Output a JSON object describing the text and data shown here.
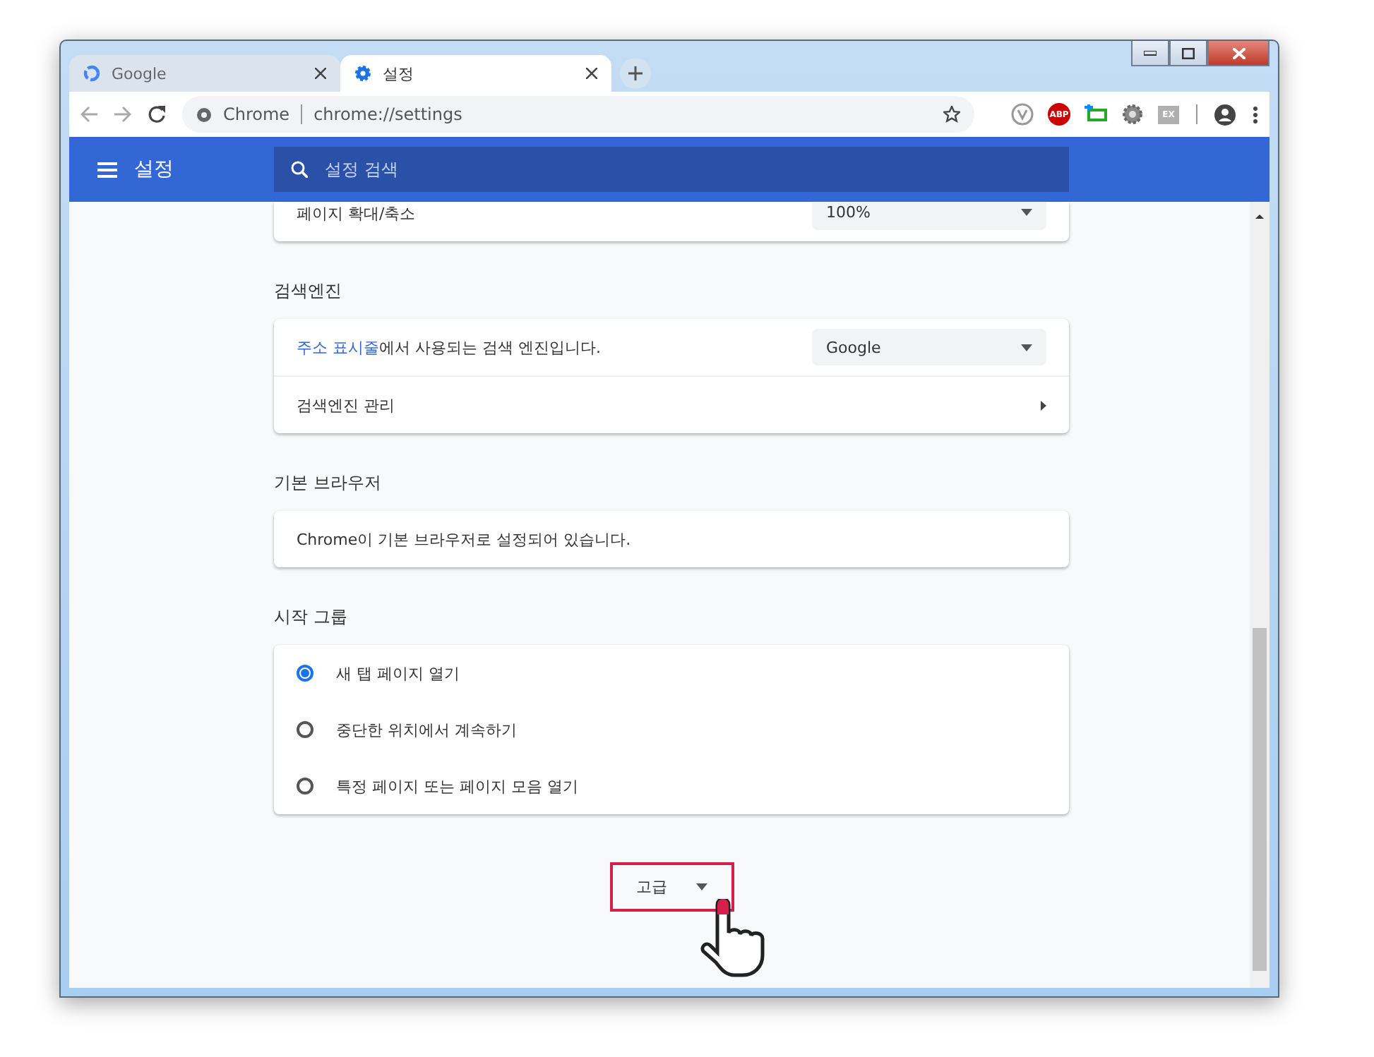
{
  "tabs": [
    {
      "title": "Google",
      "kind": "google",
      "selected": false
    },
    {
      "title": "설정",
      "kind": "gear",
      "selected": true
    }
  ],
  "address_bar": {
    "site": "Chrome",
    "url": "chrome://settings"
  },
  "extensions": [
    {
      "kind": "v"
    },
    {
      "kind": "abp",
      "label": "ABP"
    },
    {
      "kind": "tag"
    },
    {
      "kind": "gear"
    },
    {
      "kind": "ex",
      "label": "EX"
    }
  ],
  "header": {
    "title": "설정",
    "search_placeholder": "설정 검색"
  },
  "zoom_row": {
    "label": "페이지 확대/축소",
    "value": "100%"
  },
  "sections": [
    {
      "title": "검색엔진",
      "rows": [
        {
          "kind": "select",
          "link": "주소 표시줄",
          "text": "에서 사용되는 검색 엔진입니다.",
          "value": "Google"
        },
        {
          "kind": "nav",
          "text": "검색엔진 관리"
        }
      ]
    },
    {
      "title": "기본 브라우저",
      "rows": [
        {
          "kind": "text",
          "text": "Chrome이 기본 브라우저로 설정되어 있습니다."
        }
      ]
    },
    {
      "title": "시작 그룹",
      "rows": [
        {
          "kind": "radio",
          "text": "새 탭 페이지 열기",
          "selected": true
        },
        {
          "kind": "radio",
          "text": "중단한 위치에서 계속하기",
          "selected": false
        },
        {
          "kind": "radio",
          "text": "특정 페이지 또는 페이지 모음 열기",
          "selected": false
        }
      ]
    }
  ],
  "advanced_button": {
    "label": "고급",
    "highlighted": true
  }
}
